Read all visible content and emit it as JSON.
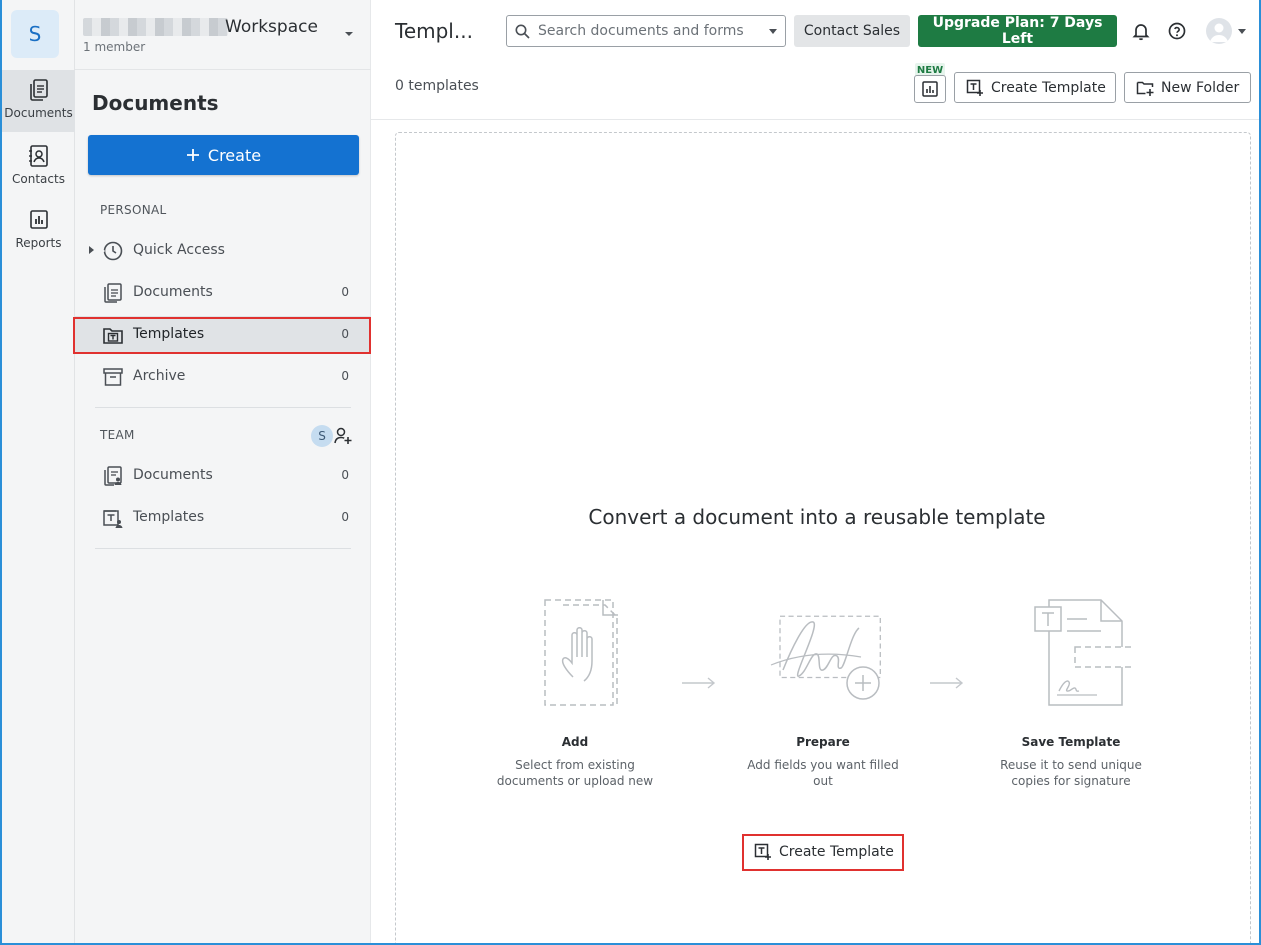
{
  "workspace": {
    "badge": "S",
    "name": "Workspace",
    "members": "1 member"
  },
  "rail": {
    "items": [
      {
        "label": "Documents",
        "icon": "documents-icon"
      },
      {
        "label": "Contacts",
        "icon": "contacts-icon"
      },
      {
        "label": "Reports",
        "icon": "reports-icon"
      }
    ]
  },
  "sidebar": {
    "title": "Documents",
    "create_label": "Create",
    "personal_label": "PERSONAL",
    "personal_items": [
      {
        "label": "Quick Access",
        "count": "",
        "icon": "clock-icon"
      },
      {
        "label": "Documents",
        "count": "0",
        "icon": "documents-icon"
      },
      {
        "label": "Templates",
        "count": "0",
        "icon": "template-folder-icon"
      },
      {
        "label": "Archive",
        "count": "0",
        "icon": "archive-icon"
      }
    ],
    "team_label": "TEAM",
    "team_avatar": "S",
    "team_items": [
      {
        "label": "Documents",
        "count": "0",
        "icon": "team-documents-icon"
      },
      {
        "label": "Templates",
        "count": "0",
        "icon": "team-templates-icon"
      }
    ]
  },
  "header": {
    "page_title": "Templ...",
    "search_placeholder": "Search documents and forms",
    "contact_sales": "Contact Sales",
    "upgrade": "Upgrade Plan: 7 Days Left"
  },
  "toolbar": {
    "count_label": "0 templates",
    "new_badge": "NEW",
    "create_template": "Create Template",
    "new_folder": "New Folder"
  },
  "empty_state": {
    "title": "Convert a document into a reusable template",
    "steps": [
      {
        "title": "Add",
        "desc_line1": "Select from existing",
        "desc_line2": "documents or upload new"
      },
      {
        "title": "Prepare",
        "desc_line1": "Add fields you want filled",
        "desc_line2": "out"
      },
      {
        "title": "Save Template",
        "desc_line1": "Reuse it to send unique",
        "desc_line2": "copies for signature"
      }
    ],
    "cta_label": "Create Template"
  },
  "colors": {
    "primary": "#1472d1",
    "upgrade": "#1e7b43",
    "highlight": "#e0312f"
  }
}
